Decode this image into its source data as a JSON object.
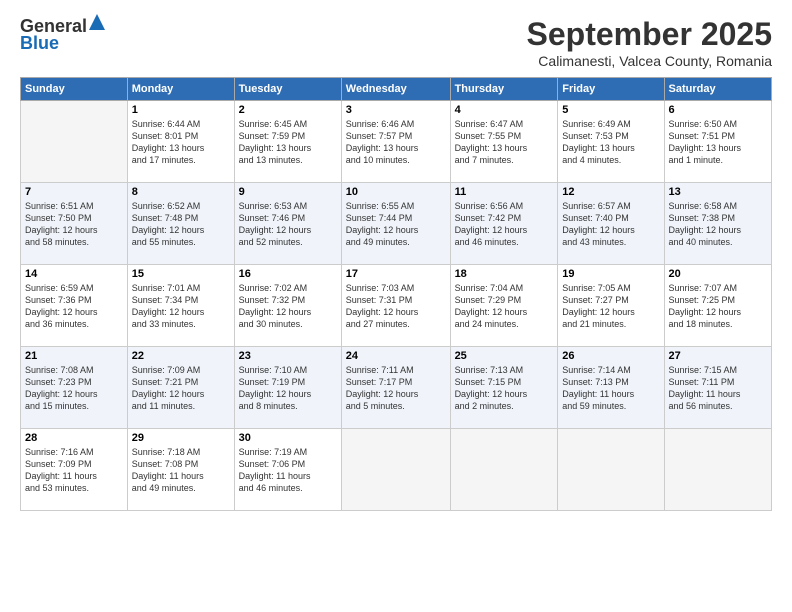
{
  "logo": {
    "general": "General",
    "blue": "Blue"
  },
  "title": "September 2025",
  "location": "Calimanesti, Valcea County, Romania",
  "headers": [
    "Sunday",
    "Monday",
    "Tuesday",
    "Wednesday",
    "Thursday",
    "Friday",
    "Saturday"
  ],
  "weeks": [
    [
      {
        "num": "",
        "info": ""
      },
      {
        "num": "1",
        "info": "Sunrise: 6:44 AM\nSunset: 8:01 PM\nDaylight: 13 hours\nand 17 minutes."
      },
      {
        "num": "2",
        "info": "Sunrise: 6:45 AM\nSunset: 7:59 PM\nDaylight: 13 hours\nand 13 minutes."
      },
      {
        "num": "3",
        "info": "Sunrise: 6:46 AM\nSunset: 7:57 PM\nDaylight: 13 hours\nand 10 minutes."
      },
      {
        "num": "4",
        "info": "Sunrise: 6:47 AM\nSunset: 7:55 PM\nDaylight: 13 hours\nand 7 minutes."
      },
      {
        "num": "5",
        "info": "Sunrise: 6:49 AM\nSunset: 7:53 PM\nDaylight: 13 hours\nand 4 minutes."
      },
      {
        "num": "6",
        "info": "Sunrise: 6:50 AM\nSunset: 7:51 PM\nDaylight: 13 hours\nand 1 minute."
      }
    ],
    [
      {
        "num": "7",
        "info": "Sunrise: 6:51 AM\nSunset: 7:50 PM\nDaylight: 12 hours\nand 58 minutes."
      },
      {
        "num": "8",
        "info": "Sunrise: 6:52 AM\nSunset: 7:48 PM\nDaylight: 12 hours\nand 55 minutes."
      },
      {
        "num": "9",
        "info": "Sunrise: 6:53 AM\nSunset: 7:46 PM\nDaylight: 12 hours\nand 52 minutes."
      },
      {
        "num": "10",
        "info": "Sunrise: 6:55 AM\nSunset: 7:44 PM\nDaylight: 12 hours\nand 49 minutes."
      },
      {
        "num": "11",
        "info": "Sunrise: 6:56 AM\nSunset: 7:42 PM\nDaylight: 12 hours\nand 46 minutes."
      },
      {
        "num": "12",
        "info": "Sunrise: 6:57 AM\nSunset: 7:40 PM\nDaylight: 12 hours\nand 43 minutes."
      },
      {
        "num": "13",
        "info": "Sunrise: 6:58 AM\nSunset: 7:38 PM\nDaylight: 12 hours\nand 40 minutes."
      }
    ],
    [
      {
        "num": "14",
        "info": "Sunrise: 6:59 AM\nSunset: 7:36 PM\nDaylight: 12 hours\nand 36 minutes."
      },
      {
        "num": "15",
        "info": "Sunrise: 7:01 AM\nSunset: 7:34 PM\nDaylight: 12 hours\nand 33 minutes."
      },
      {
        "num": "16",
        "info": "Sunrise: 7:02 AM\nSunset: 7:32 PM\nDaylight: 12 hours\nand 30 minutes."
      },
      {
        "num": "17",
        "info": "Sunrise: 7:03 AM\nSunset: 7:31 PM\nDaylight: 12 hours\nand 27 minutes."
      },
      {
        "num": "18",
        "info": "Sunrise: 7:04 AM\nSunset: 7:29 PM\nDaylight: 12 hours\nand 24 minutes."
      },
      {
        "num": "19",
        "info": "Sunrise: 7:05 AM\nSunset: 7:27 PM\nDaylight: 12 hours\nand 21 minutes."
      },
      {
        "num": "20",
        "info": "Sunrise: 7:07 AM\nSunset: 7:25 PM\nDaylight: 12 hours\nand 18 minutes."
      }
    ],
    [
      {
        "num": "21",
        "info": "Sunrise: 7:08 AM\nSunset: 7:23 PM\nDaylight: 12 hours\nand 15 minutes."
      },
      {
        "num": "22",
        "info": "Sunrise: 7:09 AM\nSunset: 7:21 PM\nDaylight: 12 hours\nand 11 minutes."
      },
      {
        "num": "23",
        "info": "Sunrise: 7:10 AM\nSunset: 7:19 PM\nDaylight: 12 hours\nand 8 minutes."
      },
      {
        "num": "24",
        "info": "Sunrise: 7:11 AM\nSunset: 7:17 PM\nDaylight: 12 hours\nand 5 minutes."
      },
      {
        "num": "25",
        "info": "Sunrise: 7:13 AM\nSunset: 7:15 PM\nDaylight: 12 hours\nand 2 minutes."
      },
      {
        "num": "26",
        "info": "Sunrise: 7:14 AM\nSunset: 7:13 PM\nDaylight: 11 hours\nand 59 minutes."
      },
      {
        "num": "27",
        "info": "Sunrise: 7:15 AM\nSunset: 7:11 PM\nDaylight: 11 hours\nand 56 minutes."
      }
    ],
    [
      {
        "num": "28",
        "info": "Sunrise: 7:16 AM\nSunset: 7:09 PM\nDaylight: 11 hours\nand 53 minutes."
      },
      {
        "num": "29",
        "info": "Sunrise: 7:18 AM\nSunset: 7:08 PM\nDaylight: 11 hours\nand 49 minutes."
      },
      {
        "num": "30",
        "info": "Sunrise: 7:19 AM\nSunset: 7:06 PM\nDaylight: 11 hours\nand 46 minutes."
      },
      {
        "num": "",
        "info": ""
      },
      {
        "num": "",
        "info": ""
      },
      {
        "num": "",
        "info": ""
      },
      {
        "num": "",
        "info": ""
      }
    ]
  ]
}
